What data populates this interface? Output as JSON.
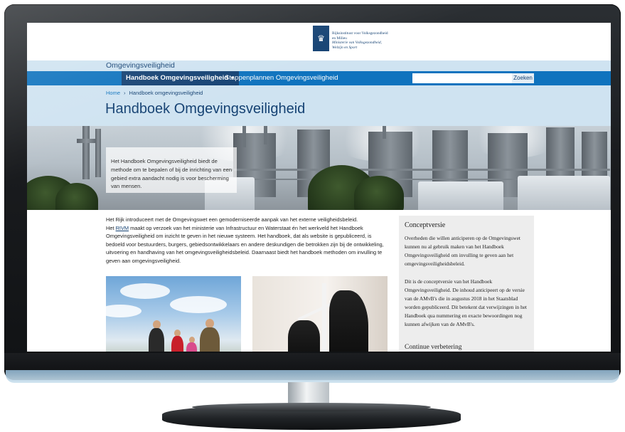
{
  "header": {
    "org_line1": "Rijksinstituut voor Volksgezondheid",
    "org_line2": "en Milieu",
    "org_line3": "Ministerie van Volksgezondheid,",
    "org_line4": "Welzijn en Sport"
  },
  "site": {
    "name": "Omgevingsveiligheid"
  },
  "nav": {
    "home_icon": "home-icon",
    "active_item": "Handboek Omgevingsveiligheid",
    "item2": "Stappenplannen Omgevingsveiligheid"
  },
  "search": {
    "placeholder": "",
    "button": "Zoeken"
  },
  "breadcrumb": {
    "home": "Home",
    "separator": "›",
    "current": "Handboek omgevingsveiligheid"
  },
  "page": {
    "title": "Handboek Omgevingsveiligheid"
  },
  "hero": {
    "text": "Het Handboek Omgevingsveiligheid biedt de methode om te bepalen of bij de inrichting van een gebied extra aandacht nodig is voor bescherming van mensen."
  },
  "intro": {
    "line1": "Het Rijk introduceert met de Omgevingswet een gemoderniseerde aanpak van het externe veiligheidsbeleid.",
    "line2_prefix": "Het ",
    "line2_link": "RIVM",
    "line2_rest": " maakt op verzoek van het ministerie van Infrastructuur en Waterstaat én het werkveld het Handboek Omgevingsveiligheid om inzicht te geven in het nieuwe systeem. Het handboek, dat als website is gepubliceerd, is bedoeld voor bestuurders, burgers, gebiedsontwikkelaars en andere deskundigen die betrokken zijn bij de ontwikkeling, uitvoering en handhaving van het omgevingsveiligheidsbeleid. Daarnaast biedt het handboek methoden om invulling te geven aan omgevingsveiligheid."
  },
  "sidebar": {
    "heading": "Conceptversie",
    "para1": "Overheden die willen anticiperen op de Omgevingswet kunnen nu al gebruik maken van het Handboek Omgevingsveiligheid om invulling te geven aan het omgevingsveiligheidsbeleid.",
    "para2": "Dit is de conceptversie van het Handboek Omgevingsveiligheid. De inhoud anticipeert op de versie van de AMvB's die in augustus 2018 in het Staatsblad worden gepubliceerd. Dit betekent dat verwijzingen in het Handboek qua nummering en exacte bewoordingen nog kunnen afwijken van de AMvB's.",
    "heading2": "Continue verbetering"
  },
  "colors": {
    "navy": "#154273",
    "nav_blue": "#0f73be",
    "light_blue": "#cfe3f1"
  }
}
